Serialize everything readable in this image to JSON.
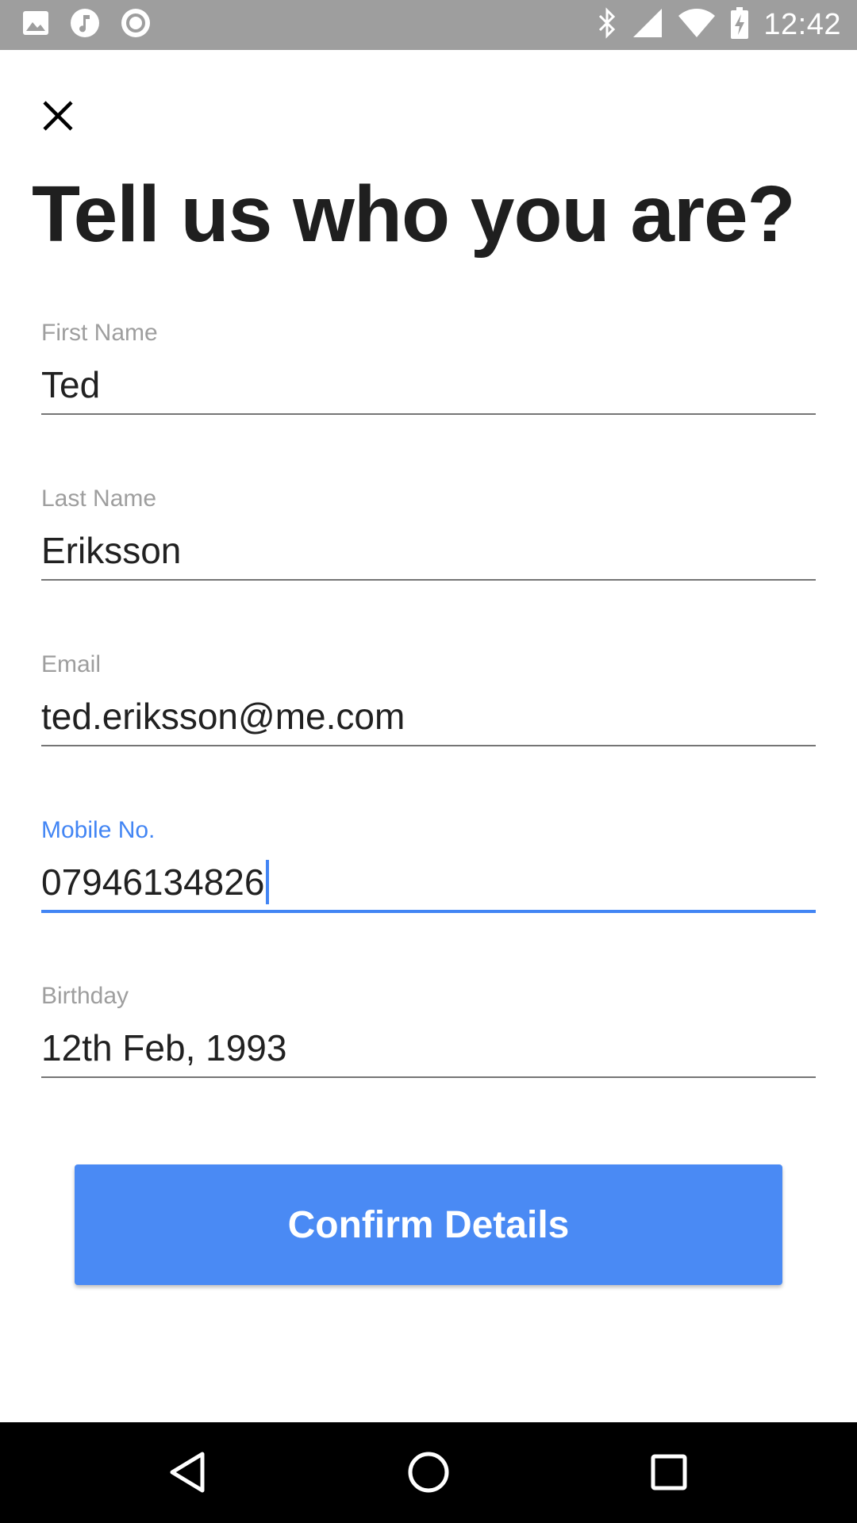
{
  "status_bar": {
    "time": "12:42",
    "left_icons": [
      "image-icon",
      "music-icon",
      "record-icon"
    ],
    "right_icons": [
      "bluetooth-icon",
      "signal-icon",
      "wifi-icon",
      "battery-charging-icon"
    ]
  },
  "header": {
    "close_icon": "close-icon",
    "title": "Tell us who you are?"
  },
  "form": {
    "first_name": {
      "label": "First Name",
      "value": "Ted"
    },
    "last_name": {
      "label": "Last Name",
      "value": "Eriksson"
    },
    "email": {
      "label": "Email",
      "value": "ted.eriksson@me.com"
    },
    "mobile": {
      "label": "Mobile No.",
      "value": "07946134826",
      "focused": true
    },
    "birthday": {
      "label": "Birthday",
      "value": "12th Feb, 1993"
    }
  },
  "confirm_button": {
    "label": "Confirm Details"
  },
  "nav_bar": {
    "icons": [
      "back-icon",
      "home-icon",
      "recents-icon"
    ]
  },
  "colors": {
    "accent": "#4285f4",
    "button": "#4a8af4",
    "status_bar": "#9e9e9e",
    "label": "#9e9e9e",
    "text": "#212121"
  }
}
